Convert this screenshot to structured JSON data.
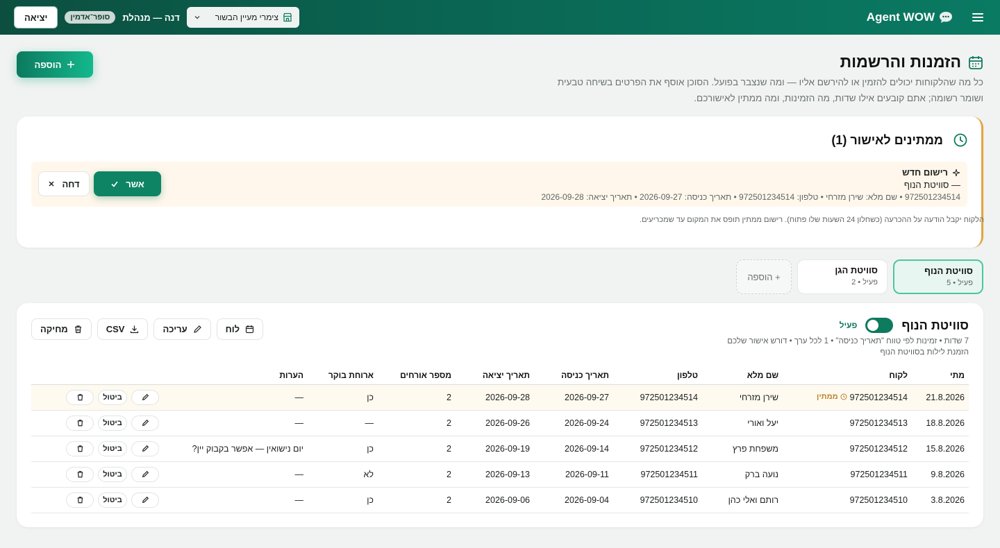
{
  "topbar": {
    "brand": "Agent WOW",
    "venue": "צימרי מעיין הבשור",
    "user": "דנה — מנהלת",
    "role_badge": "סופר־אדמין",
    "logout": "יציאה"
  },
  "header": {
    "title": "הזמנות והרשמות",
    "description": "כל מה שהלקוחות יכולים להזמין או להירשם אליו — ומה שנצבר בפועל. הסוכן אוסף את הפרטים בשיחה טבעית ושומר רשומה; אתם קובעים אילו שדות, מה הזמינות, ומה ממתין לאישורכם.",
    "add_button": "הוספה"
  },
  "pending": {
    "title": "ממתינים לאישור (1)",
    "item": {
      "title": "רישום חדש",
      "subtitle": "— סוויטת הנוף",
      "details": "972501234514 • שם מלא: שירן מזרחי • טלפון: 972501234514 • תאריך כניסה: 2026-09-27 • תאריך יציאה: 2026-09-28",
      "approve": "אשר",
      "reject": "דחה"
    },
    "note": "הלקוח יקבל הודעה על ההכרעה (כשחלון 24 השעות שלו פתוח). רישום ממתין תופס את המקום עד שמכריעים."
  },
  "tabs": [
    {
      "name": "סוויטת הנוף",
      "meta": "פעיל • 5"
    },
    {
      "name": "סוויטת הגן",
      "meta": "פעיל • 2"
    }
  ],
  "tab_add": "+ הוספה",
  "section": {
    "name": "סוויטת הנוף",
    "status": "פעיל",
    "meta_line1": "7 שדות • זמינות לפי טווח \"תאריך כניסה\" • 1 לכל ערך • דורש אישור שלכם",
    "meta_line2": "הזמנת לילות בסוויטת הנוף",
    "actions": {
      "calendar": "לוח",
      "edit": "עריכה",
      "csv": "CSV",
      "delete": "מחיקה"
    }
  },
  "table": {
    "headers": [
      "מתי",
      "לקוח",
      "שם מלא",
      "טלפון",
      "תאריך כניסה",
      "תאריך יציאה",
      "מספר אורחים",
      "ארוחת בוקר",
      "הערות",
      ""
    ],
    "pending_label": "ממתין",
    "cancel_label": "ביטול",
    "rows": [
      {
        "when": "21.8.2026",
        "customer": "972501234514",
        "name": "שירן מזרחי",
        "phone": "972501234514",
        "checkin": "2026-09-27",
        "checkout": "2026-09-28",
        "guests": "2",
        "breakfast": "כן",
        "notes": "—"
      },
      {
        "when": "18.8.2026",
        "customer": "972501234513",
        "name": "יעל ואורי",
        "phone": "972501234513",
        "checkin": "2026-09-24",
        "checkout": "2026-09-26",
        "guests": "2",
        "breakfast": "—",
        "notes": "—"
      },
      {
        "when": "15.8.2026",
        "customer": "972501234512",
        "name": "משפחת פרץ",
        "phone": "972501234512",
        "checkin": "2026-09-14",
        "checkout": "2026-09-19",
        "guests": "2",
        "breakfast": "כן",
        "notes": "יום נישואין — אפשר בקבוק יין?"
      },
      {
        "when": "9.8.2026",
        "customer": "972501234511",
        "name": "נועה ברק",
        "phone": "972501234511",
        "checkin": "2026-09-11",
        "checkout": "2026-09-13",
        "guests": "2",
        "breakfast": "לא",
        "notes": "—"
      },
      {
        "when": "3.8.2026",
        "customer": "972501234510",
        "name": "רותם ואלי כהן",
        "phone": "972501234510",
        "checkin": "2026-09-04",
        "checkout": "2026-09-06",
        "guests": "2",
        "breakfast": "כן",
        "notes": "—"
      }
    ]
  },
  "colors": {
    "primary": "#0e7a5e",
    "accent": "#14b88d",
    "pending": "#e6a33c"
  }
}
